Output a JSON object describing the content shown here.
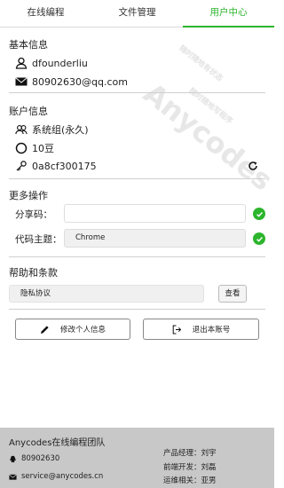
{
  "tabs": [
    {
      "label": "在线编程",
      "active": false
    },
    {
      "label": "文件管理",
      "active": false
    },
    {
      "label": "用户中心",
      "active": true
    }
  ],
  "basic": {
    "title": "基本信息",
    "username": "dfounderliu",
    "email": "80902630@qq.com"
  },
  "account": {
    "title": "账户信息",
    "group": "系统组(永久)",
    "beans": "10豆",
    "key": "0a8cf300175"
  },
  "more": {
    "title": "更多操作",
    "share_label": "分享码：",
    "share_value": "",
    "theme_label": "代码主题：",
    "theme_value": "Chrome"
  },
  "help": {
    "title": "帮助和条款",
    "privacy": "隐私协议",
    "view_button": "查看"
  },
  "actions": {
    "edit": "修改个人信息",
    "logout": "退出本账号"
  },
  "footer": {
    "team": "Anycodes在线编程团队",
    "qq": "80902630",
    "mail": "service@anycodes.cn",
    "pm": "产品经理：刘宇",
    "frontend": "前端开发：刘磊",
    "ops": "运维相关：亚男"
  },
  "watermark": {
    "brand": "Anycodes",
    "line1": "随时随地有状态",
    "line2": "随时随地写程序"
  },
  "colors": {
    "accent": "#2db52d",
    "footer_bg": "#c8c8c8"
  }
}
